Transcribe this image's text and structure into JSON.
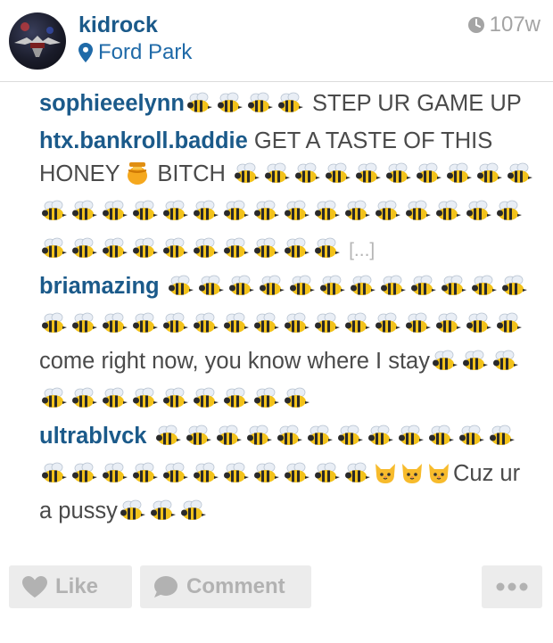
{
  "post": {
    "username": "kidrock",
    "location": "Ford Park",
    "time_ago": "107w",
    "location_icon": "map-pin-icon",
    "time_icon": "clock-icon"
  },
  "comments": [
    {
      "author": "sophieeelynn",
      "parts": [
        {
          "emoji": "bee",
          "n": 4
        },
        {
          "text": " STEP UR GAME UP"
        }
      ]
    },
    {
      "author": "htx.bankroll.baddie",
      "parts": [
        {
          "text": " GET A TASTE OF THIS HONEY "
        },
        {
          "emoji": "honey-pot",
          "n": 1
        },
        {
          "text": " BITCH "
        },
        {
          "emoji": "bee",
          "n": 36
        },
        {
          "text": " "
        },
        {
          "more": "[...]"
        }
      ]
    },
    {
      "author": "briamazing",
      "parts": [
        {
          "text": " "
        },
        {
          "emoji": "bee",
          "n": 28
        },
        {
          "text": "come right now, you know where I stay"
        },
        {
          "emoji": "bee",
          "n": 12
        }
      ]
    },
    {
      "author": "ultrablvck",
      "parts": [
        {
          "text": " "
        },
        {
          "emoji": "bee",
          "n": 23
        },
        {
          "emoji": "cat",
          "n": 3
        },
        {
          "text": "Cuz ur a pussy"
        },
        {
          "emoji": "bee",
          "n": 3
        }
      ]
    }
  ],
  "actions": {
    "like_label": "Like",
    "comment_label": "Comment",
    "like_icon": "heart-icon",
    "comment_icon": "speech-bubble-icon",
    "more_icon": "ellipsis-icon"
  },
  "colors": {
    "username": "#1b5a8a",
    "link": "#1f6aa8",
    "muted": "#a4a4a4",
    "button_bg": "#ececec"
  }
}
